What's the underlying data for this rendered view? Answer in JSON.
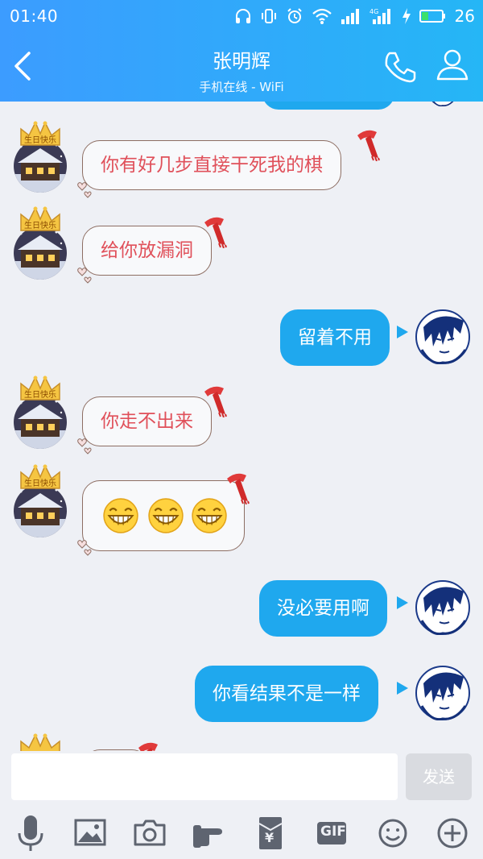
{
  "status_bar": {
    "time": "01:40",
    "battery": "26",
    "network": "4G"
  },
  "header": {
    "title": "张明辉",
    "subtitle": "手机在线 - WiFi"
  },
  "avatar": {
    "crown_text": "生日快乐"
  },
  "messages": [
    {
      "side": "left",
      "text": "你有好几步直接干死我的棋"
    },
    {
      "side": "left",
      "text": "给你放漏洞"
    },
    {
      "side": "right",
      "text": "留着不用"
    },
    {
      "side": "left",
      "text": "你走不出来"
    },
    {
      "side": "left",
      "emoji": [
        "grin-emoji",
        "grin-emoji",
        "grin-emoji"
      ]
    },
    {
      "side": "right",
      "text": "没必要用啊"
    },
    {
      "side": "right",
      "text": "你看结果不是一样"
    }
  ],
  "input": {
    "value": "",
    "placeholder": "",
    "send_label": "发送"
  },
  "toolbar": {
    "gif_label": "GIF",
    "redpacket_label": "¥"
  },
  "icons": [
    "back-icon",
    "phone-icon",
    "profile-icon",
    "headphones-icon",
    "vibrate-icon",
    "alarm-icon",
    "wifi-icon",
    "signal-icon",
    "battery-icon",
    "mic-icon",
    "image-icon",
    "camera-icon",
    "poke-icon",
    "red-packet-icon",
    "gif-icon",
    "emoji-icon",
    "plus-icon"
  ],
  "colors": {
    "header_start": "#3c9cff",
    "header_end": "#25b6f6",
    "bubble_sent": "#1fa8ee",
    "bubble_received_text": "#e0505a",
    "chat_bg": "#eef0f5"
  }
}
